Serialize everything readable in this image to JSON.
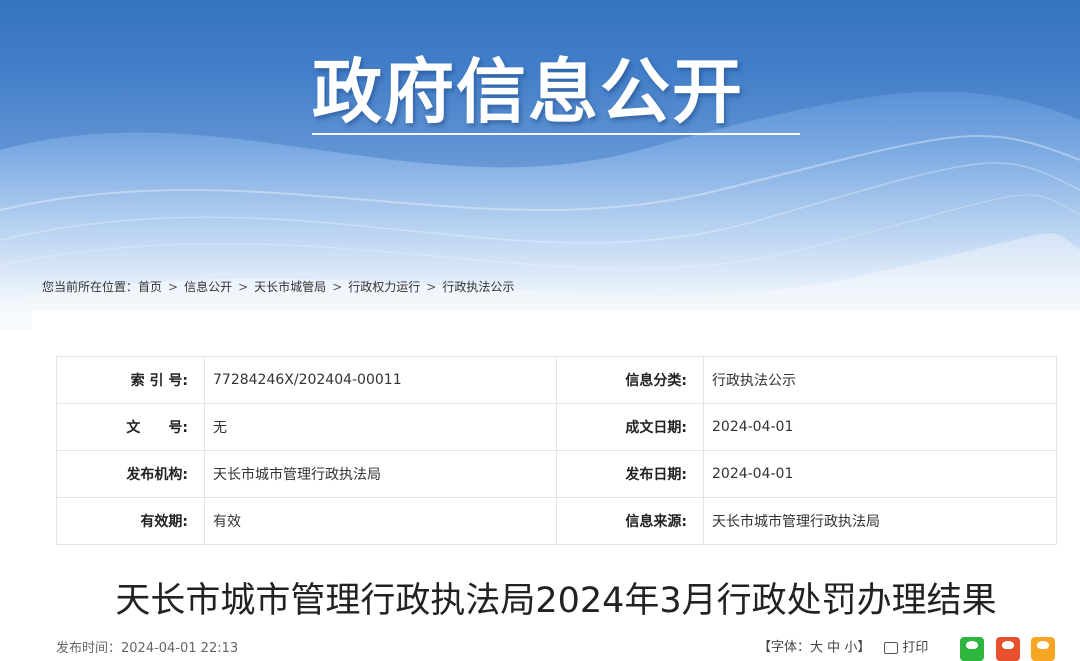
{
  "banner": {
    "title": "政府信息公开"
  },
  "breadcrumb": {
    "prefix": "您当前所在位置：",
    "items": [
      "首页",
      "信息公开",
      "天长市城管局",
      "行政权力运行",
      "行政执法公示"
    ],
    "separator": ">"
  },
  "meta": {
    "index_label": "索 引 号:",
    "index_value": "77284246X/202404-00011",
    "category_label": "信息分类:",
    "category_value": "行政执法公示",
    "docno_label": "文　　号:",
    "docno_value": "无",
    "created_label": "成文日期:",
    "created_value": "2024-04-01",
    "org_label": "发布机构:",
    "org_value": "天长市城市管理行政执法局",
    "published_label": "发布日期:",
    "published_value": "2024-04-01",
    "validity_label": "有效期:",
    "validity_value": "有效",
    "source_label": "信息来源:",
    "source_value": "天长市城市管理行政执法局"
  },
  "article": {
    "title": "天长市城市管理行政执法局2024年3月行政处罚办理结果",
    "publish_time": "发布时间：2024-04-01 22:13"
  },
  "tools": {
    "font_size_label": "【字体：",
    "font_large": "大",
    "font_medium": "中",
    "font_small": "小",
    "font_size_end": "】",
    "print_label": "打印"
  },
  "colors": {
    "banner_top": "#3a78c4",
    "wechat": "#2fb63e",
    "weibo": "#e8512f",
    "qzone": "#f6a623"
  },
  "icons": {
    "print": "print-icon",
    "wechat": "wechat-icon",
    "weibo": "weibo-icon",
    "qzone": "qzone-icon"
  }
}
